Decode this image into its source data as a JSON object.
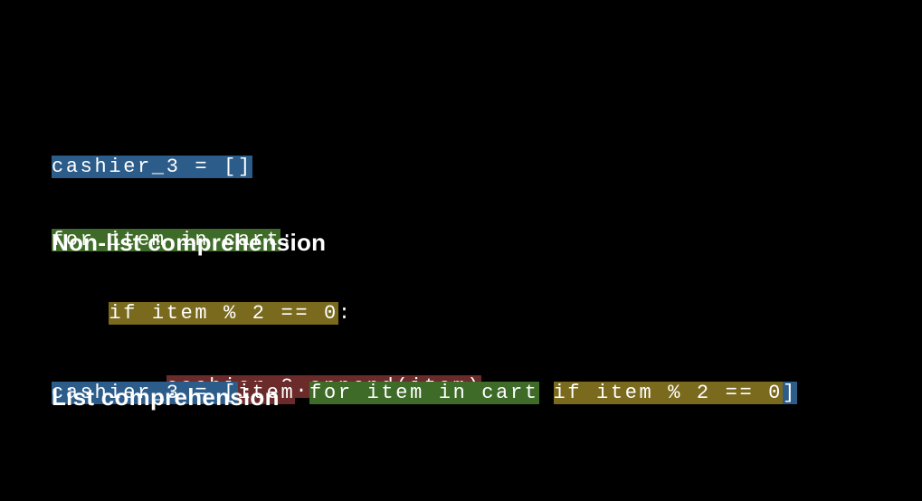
{
  "colors": {
    "blue": "#2c5c8a",
    "green": "#3e6b28",
    "olive": "#7a6a1e",
    "maroon": "#6b2b2b",
    "bg": "#000000",
    "fg": "#ffffff"
  },
  "nonlist": {
    "line1_assign": "cashier_3 = []",
    "line2_for": "for item in cart",
    "line2_colon": ":",
    "line3_indent": "    ",
    "line3_if": "if item % 2 == 0",
    "line3_colon": ":",
    "line4_indent": "        ",
    "line4_body": "cashier_3.append(item)"
  },
  "headings": {
    "nonlist": "Non-list comprehension",
    "list": "List comprehension"
  },
  "listcomp": {
    "assign": "cashier_3 = ",
    "lbracket": "[",
    "expr": "item",
    "space1": " ",
    "for": "for item in cart",
    "space2": " ",
    "cond": "if item % 2 == 0",
    "rbracket": "]"
  }
}
